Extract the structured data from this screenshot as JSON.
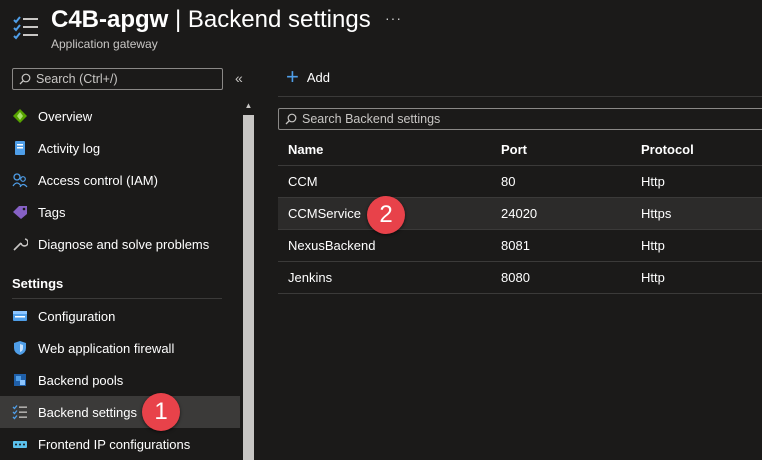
{
  "header": {
    "resource_name": "C4B-apgw",
    "separator": "|",
    "page_name": "Backend settings",
    "more": "···",
    "subtitle": "Application gateway"
  },
  "sidebar": {
    "search_placeholder": "Search (Ctrl+/)",
    "collapse": "«",
    "items": [
      {
        "label": "Overview",
        "icon": "overview-icon"
      },
      {
        "label": "Activity log",
        "icon": "activity-log-icon"
      },
      {
        "label": "Access control (IAM)",
        "icon": "iam-icon"
      },
      {
        "label": "Tags",
        "icon": "tag-icon"
      },
      {
        "label": "Diagnose and solve problems",
        "icon": "wrench-icon"
      }
    ],
    "section_settings": "Settings",
    "settings_items": [
      {
        "label": "Configuration",
        "icon": "configuration-icon"
      },
      {
        "label": "Web application firewall",
        "icon": "shield-icon"
      },
      {
        "label": "Backend pools",
        "icon": "backend-pools-icon"
      },
      {
        "label": "Backend settings",
        "icon": "list-icon",
        "active": true
      },
      {
        "label": "Frontend IP configurations",
        "icon": "frontend-ip-icon"
      }
    ]
  },
  "main": {
    "add_label": "Add",
    "search_placeholder": "Search Backend settings",
    "columns": [
      "Name",
      "Port",
      "Protocol"
    ],
    "rows": [
      {
        "name": "CCM",
        "port": "80",
        "protocol": "Http"
      },
      {
        "name": "CCMService",
        "port": "24020",
        "protocol": "Https"
      },
      {
        "name": "NexusBackend",
        "port": "8081",
        "protocol": "Http"
      },
      {
        "name": "Jenkins",
        "port": "8080",
        "protocol": "Http"
      }
    ]
  },
  "callouts": {
    "one": "1",
    "two": "2"
  },
  "colors": {
    "accent": "#4f9ee8",
    "callout": "#e8424a",
    "background": "#1b1a19"
  }
}
